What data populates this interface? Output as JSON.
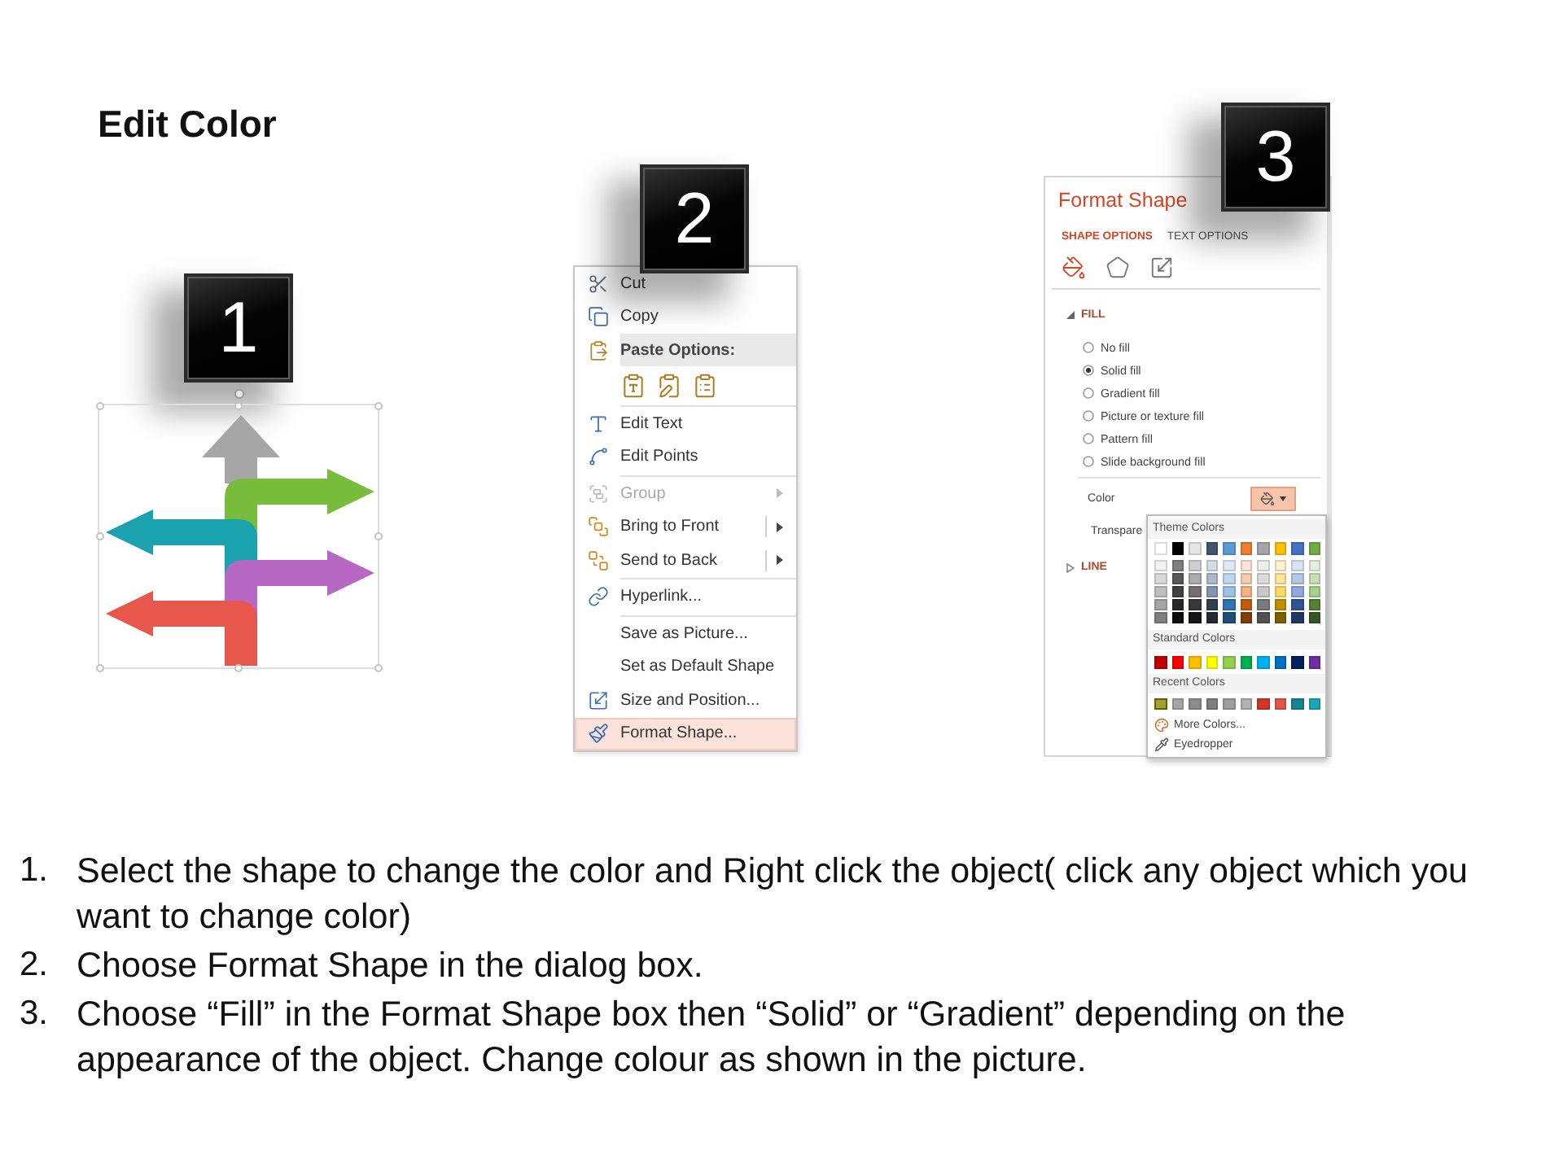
{
  "title": "Edit Color",
  "step_1": {
    "badge": "1",
    "arrows": [
      {
        "kind": "up",
        "color": "#a6a6a6"
      },
      {
        "kind": "right",
        "color": "#77bd3b"
      },
      {
        "kind": "left",
        "color": "#1aa3af"
      },
      {
        "kind": "right",
        "color": "#b767c4"
      },
      {
        "kind": "left",
        "color": "#e8574b"
      }
    ]
  },
  "step_2": {
    "badge": "2",
    "context_menu": {
      "sections": [
        {
          "items": [
            {
              "label": "Cut",
              "disabled": false,
              "submenu": false,
              "split": false,
              "selected": false
            },
            {
              "label": "Copy",
              "disabled": false,
              "submenu": false,
              "split": false,
              "selected": false
            }
          ],
          "paste_options": {
            "label": "Paste Options:"
          }
        },
        {
          "items": [
            {
              "label": "Edit Text",
              "disabled": false,
              "submenu": false,
              "split": false,
              "selected": false
            },
            {
              "label": "Edit Points",
              "disabled": false,
              "submenu": false,
              "split": false,
              "selected": false
            }
          ]
        },
        {
          "items": [
            {
              "label": "Group",
              "disabled": true,
              "submenu": true,
              "split": false,
              "selected": false
            },
            {
              "label": "Bring to Front",
              "disabled": false,
              "submenu": true,
              "split": true,
              "selected": false
            },
            {
              "label": "Send to Back",
              "disabled": false,
              "submenu": true,
              "split": true,
              "selected": false
            }
          ]
        },
        {
          "items": [
            {
              "label": "Hyperlink...",
              "disabled": false,
              "submenu": false,
              "split": false,
              "selected": false
            }
          ]
        },
        {
          "items": [
            {
              "label": "Save as Picture...",
              "disabled": false,
              "submenu": false,
              "split": false,
              "selected": false
            },
            {
              "label": "Set as Default Shape",
              "disabled": false,
              "submenu": false,
              "split": false,
              "selected": false
            },
            {
              "label": "Size and Position...",
              "disabled": false,
              "submenu": false,
              "split": false,
              "selected": false
            },
            {
              "label": "Format Shape...",
              "disabled": false,
              "submenu": false,
              "split": false,
              "selected": true
            }
          ]
        }
      ]
    }
  },
  "step_3": {
    "badge": "3",
    "format_panel": {
      "title": "Format Shape",
      "tabs": [
        {
          "label": "SHAPE OPTIONS",
          "selected": true
        },
        {
          "label": "TEXT OPTIONS",
          "selected": false
        }
      ],
      "category_icons": [
        {
          "selected": true
        },
        {
          "selected": false
        },
        {
          "selected": false
        }
      ],
      "fill_section": {
        "label": "FILL",
        "expanded": true,
        "options": [
          {
            "label": "No fill",
            "selected": false
          },
          {
            "label": "Solid fill",
            "selected": true
          },
          {
            "label": "Gradient fill",
            "selected": false
          },
          {
            "label": "Picture or texture fill",
            "selected": false
          },
          {
            "label": "Pattern fill",
            "selected": false
          },
          {
            "label": "Slide background fill",
            "selected": false
          }
        ],
        "color_label": "Color",
        "transparency_label": "Transpare"
      },
      "line_section": {
        "label": "LINE",
        "expanded": false
      },
      "color_picker": {
        "theme_label": "Theme Colors",
        "theme_colors": [
          {
            "color": "#ffffff"
          },
          {
            "color": "#000000"
          },
          {
            "color": "#e7e6e6"
          },
          {
            "color": "#44546a"
          },
          {
            "color": "#5b9bd5"
          },
          {
            "color": "#ed7d31"
          },
          {
            "color": "#a5a5a5"
          },
          {
            "color": "#ffc000"
          },
          {
            "color": "#4472c4"
          },
          {
            "color": "#70ad47"
          }
        ],
        "theme_shades": [
          [
            {
              "color": "#f2f2f2"
            },
            {
              "color": "#7f7f7f"
            },
            {
              "color": "#d0cece"
            },
            {
              "color": "#d6dce4"
            },
            {
              "color": "#deebf6"
            },
            {
              "color": "#fbe5d5"
            },
            {
              "color": "#ededed"
            },
            {
              "color": "#fff2cc"
            },
            {
              "color": "#dae3f3"
            },
            {
              "color": "#e2efd9"
            }
          ],
          [
            {
              "color": "#d9d9d9"
            },
            {
              "color": "#595959"
            },
            {
              "color": "#aeabab"
            },
            {
              "color": "#adb9ca"
            },
            {
              "color": "#bdd7ee"
            },
            {
              "color": "#f7cbac"
            },
            {
              "color": "#dbdbdb"
            },
            {
              "color": "#fee599"
            },
            {
              "color": "#b4c7e7"
            },
            {
              "color": "#c5e0b3"
            }
          ],
          [
            {
              "color": "#bfbfbf"
            },
            {
              "color": "#404040"
            },
            {
              "color": "#757070"
            },
            {
              "color": "#8497b0"
            },
            {
              "color": "#9cc3e5"
            },
            {
              "color": "#f4b183"
            },
            {
              "color": "#c9c9c9"
            },
            {
              "color": "#ffd965"
            },
            {
              "color": "#8faadc"
            },
            {
              "color": "#a8d08d"
            }
          ],
          [
            {
              "color": "#a6a6a6"
            },
            {
              "color": "#262626"
            },
            {
              "color": "#3a3838"
            },
            {
              "color": "#333f4f"
            },
            {
              "color": "#2e75b5"
            },
            {
              "color": "#c55a11"
            },
            {
              "color": "#7b7b7b"
            },
            {
              "color": "#bf9000"
            },
            {
              "color": "#2f5496"
            },
            {
              "color": "#538135"
            }
          ],
          [
            {
              "color": "#808080"
            },
            {
              "color": "#0d0d0d"
            },
            {
              "color": "#171616"
            },
            {
              "color": "#222a35"
            },
            {
              "color": "#1f4e79"
            },
            {
              "color": "#833c0b"
            },
            {
              "color": "#525252"
            },
            {
              "color": "#7f6000"
            },
            {
              "color": "#1f3864"
            },
            {
              "color": "#375623"
            }
          ]
        ],
        "standard_label": "Standard Colors",
        "standard_colors": [
          {
            "color": "#c00000"
          },
          {
            "color": "#ff0000"
          },
          {
            "color": "#ffc000"
          },
          {
            "color": "#ffff00"
          },
          {
            "color": "#92d050"
          },
          {
            "color": "#00b050"
          },
          {
            "color": "#00b0f0"
          },
          {
            "color": "#0070c0"
          },
          {
            "color": "#002060"
          },
          {
            "color": "#7030a0"
          }
        ],
        "recent_label": "Recent Colors",
        "recent_colors": [
          {
            "color": "#9aa534",
            "selected": true
          },
          {
            "color": "#a5a5a5",
            "selected": false
          },
          {
            "color": "#8c8c8c",
            "selected": false
          },
          {
            "color": "#7f7f7f",
            "selected": false
          },
          {
            "color": "#9e9e9e",
            "selected": false
          },
          {
            "color": "#b2b2b2",
            "selected": false
          },
          {
            "color": "#d0372b",
            "selected": false
          },
          {
            "color": "#e0584a",
            "selected": false
          },
          {
            "color": "#17858f",
            "selected": false
          },
          {
            "color": "#1ba8b5",
            "selected": false
          }
        ],
        "more_colors": "More Colors...",
        "eyedropper": "Eyedropper"
      }
    }
  },
  "instructions": [
    {
      "number": "1.",
      "text": "Select the shape to change the color and Right click the object( click any object which you want to change color)"
    },
    {
      "number": "2.",
      "text": "Choose Format Shape in the dialog box."
    },
    {
      "number": "3.",
      "text": "Choose “Fill” in the Format Shape box then “Solid” or “Gradient” depending on the appearance of the object. Change colour as shown in the picture."
    }
  ]
}
